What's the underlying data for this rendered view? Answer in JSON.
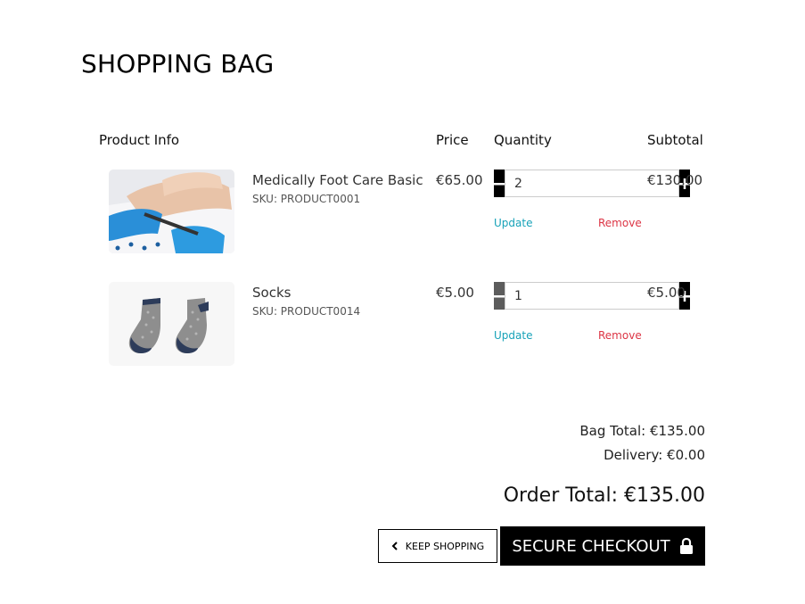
{
  "page": {
    "title": "SHOPPING BAG"
  },
  "columns": {
    "product_info": "Product Info",
    "price": "Price",
    "quantity": "Quantity",
    "subtotal": "Subtotal"
  },
  "items": [
    {
      "name": "Medically Foot Care Basic",
      "sku": "SKU: PRODUCT0001",
      "price": "€65.00",
      "quantity": "2",
      "subtotal": "€130.00",
      "update_label": "Update",
      "remove_label": "Remove"
    },
    {
      "name": "Socks",
      "sku": "SKU: PRODUCT0014",
      "price": "€5.00",
      "quantity": "1",
      "subtotal": "€5.00",
      "update_label": "Update",
      "remove_label": "Remove"
    }
  ],
  "summary": {
    "bag_total": "Bag Total: €135.00",
    "delivery": "Delivery: €0.00",
    "order_total": "Order Total: €135.00"
  },
  "actions": {
    "keep_shopping": "KEEP SHOPPING",
    "secure_checkout": "SECURE CHECKOUT"
  },
  "icons": {
    "minus": "minus-icon",
    "plus": "plus-icon",
    "chevron_left": "chevron-left-icon",
    "lock": "lock-icon"
  },
  "colors": {
    "update_link": "#17a2b8",
    "remove_link": "#dc3545",
    "button_dark": "#000000",
    "button_disabled": "#5c5c5c"
  }
}
